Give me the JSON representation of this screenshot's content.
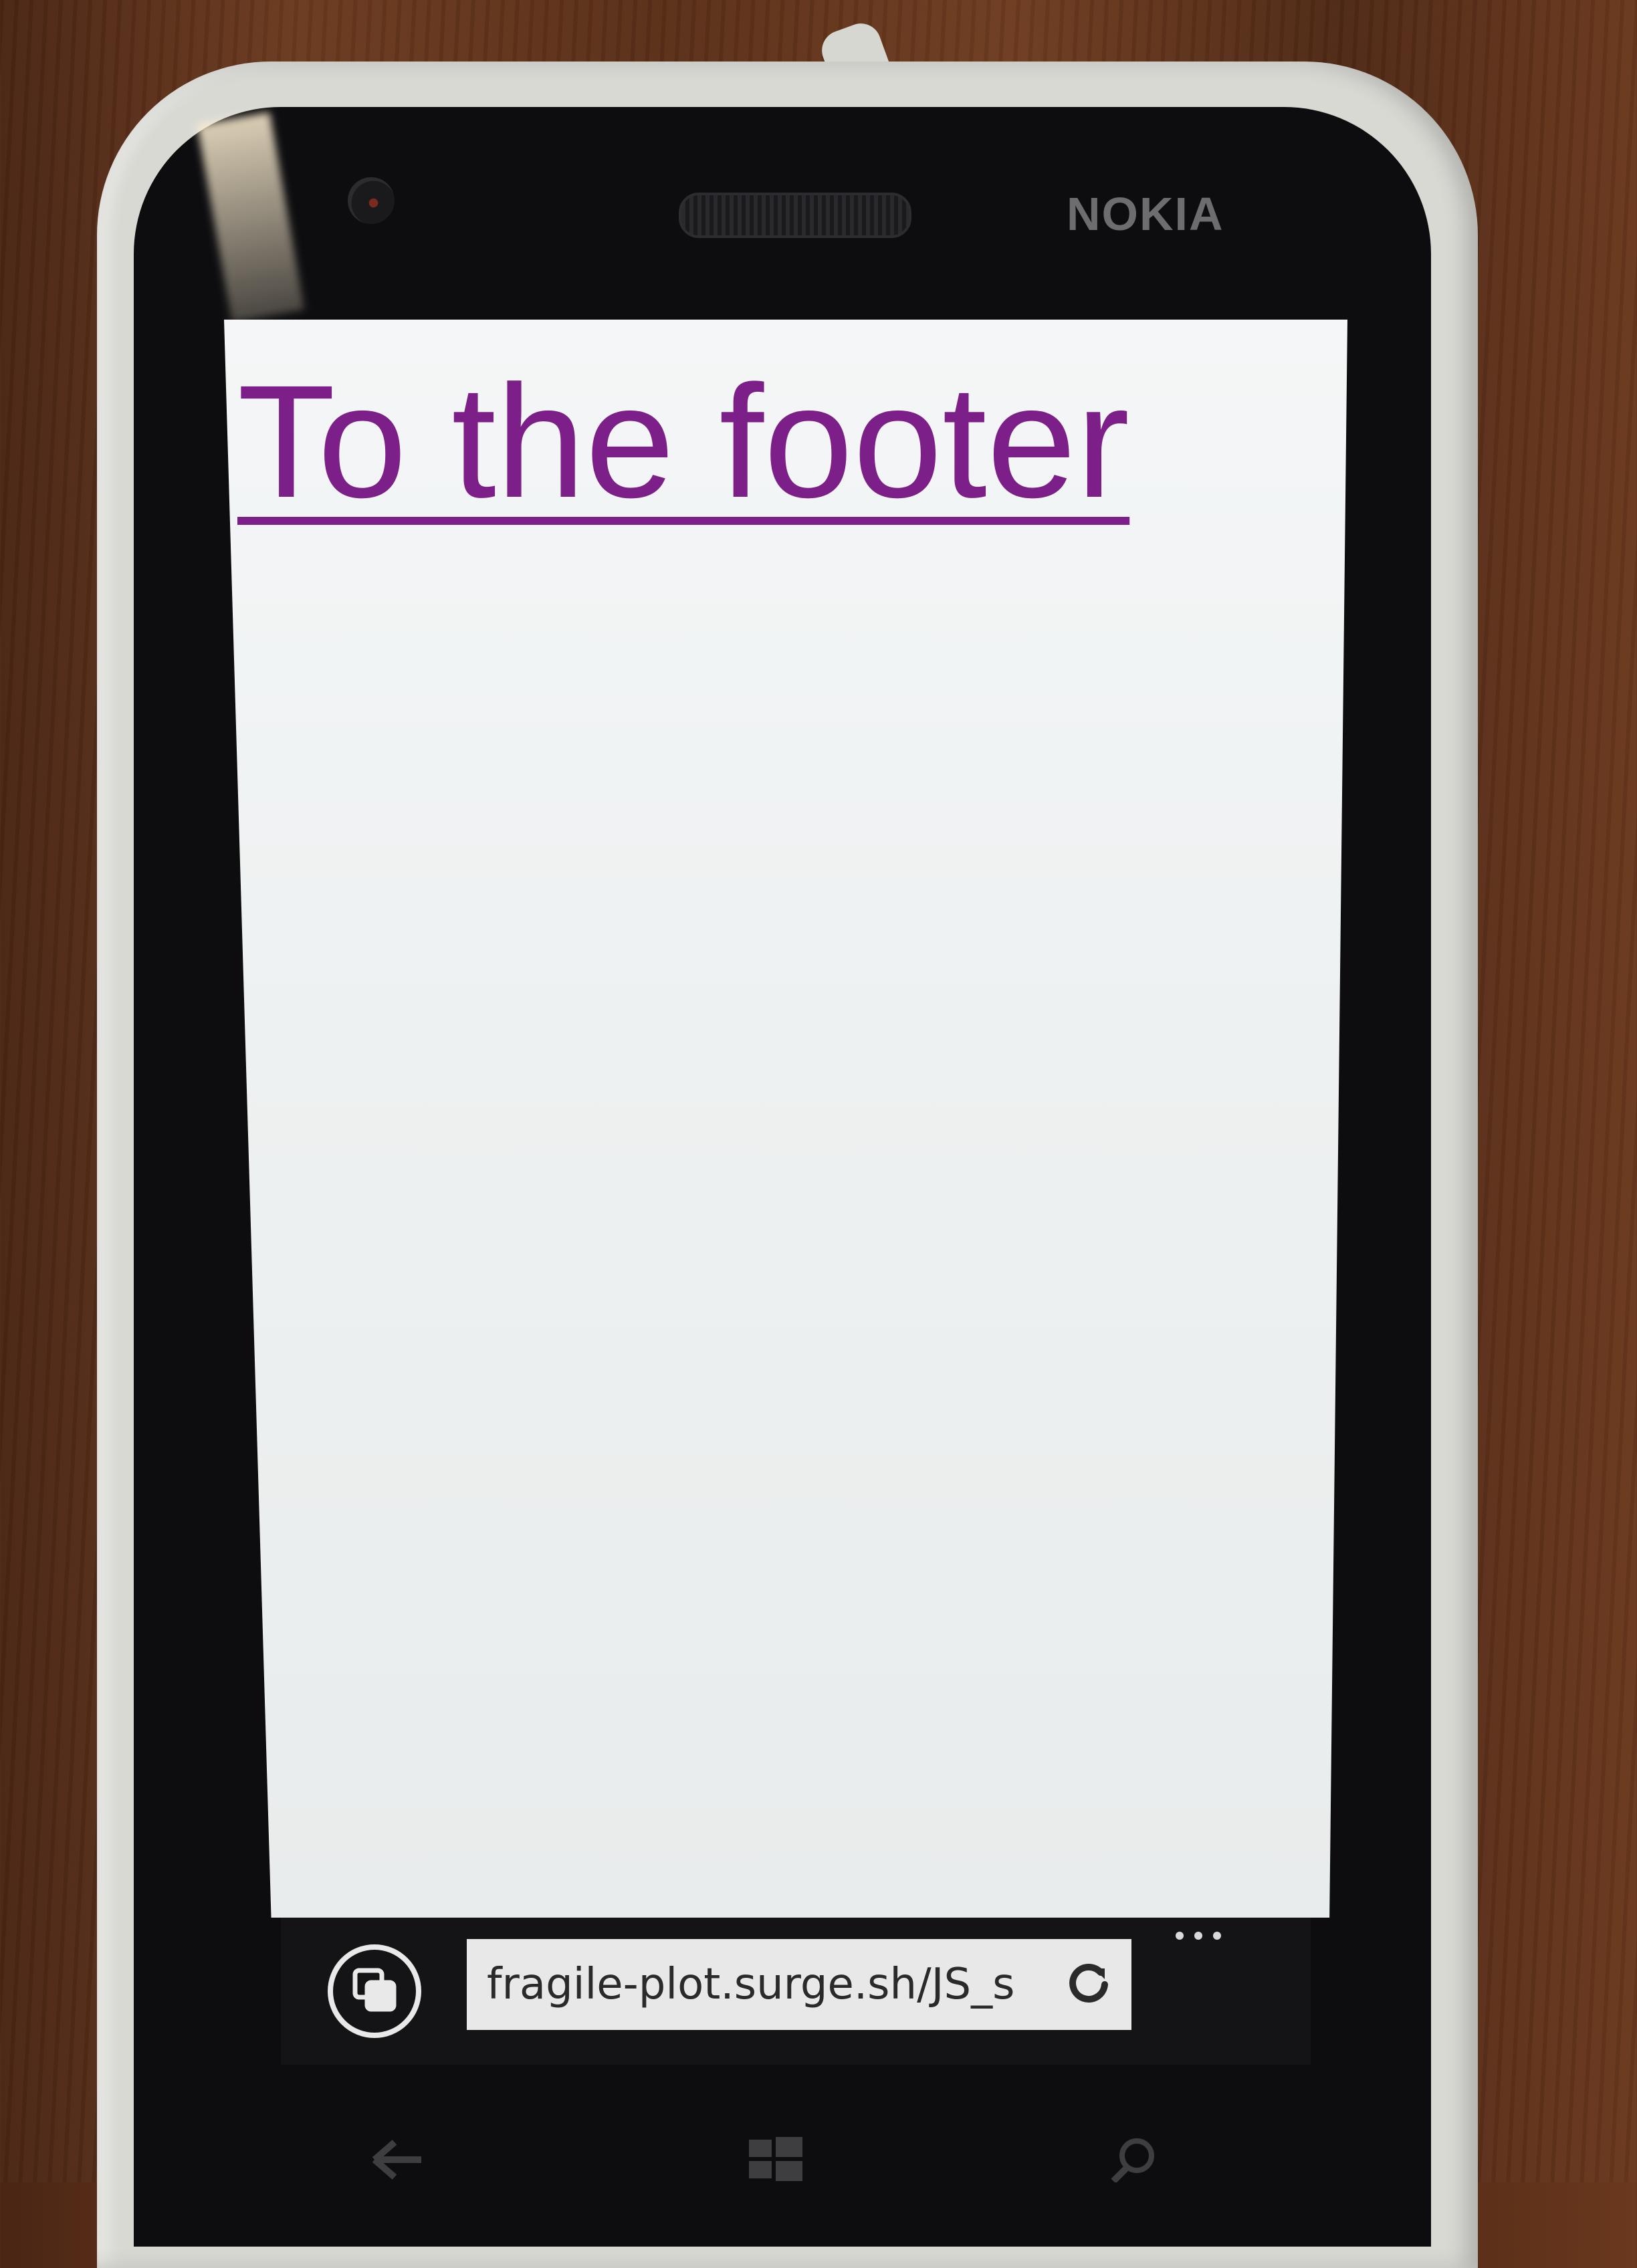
{
  "device": {
    "brand": "NOKIA"
  },
  "page": {
    "link_text": "To the footer",
    "link_color": "#7d1f88"
  },
  "browser": {
    "address": "fragile-plot.surge.sh/JS_s",
    "icons": {
      "tabs": "tabs-icon",
      "refresh": "refresh-icon",
      "more": "more-icon"
    }
  },
  "hardware_keys": {
    "icons": [
      "back-icon",
      "windows-icon",
      "search-icon"
    ]
  }
}
